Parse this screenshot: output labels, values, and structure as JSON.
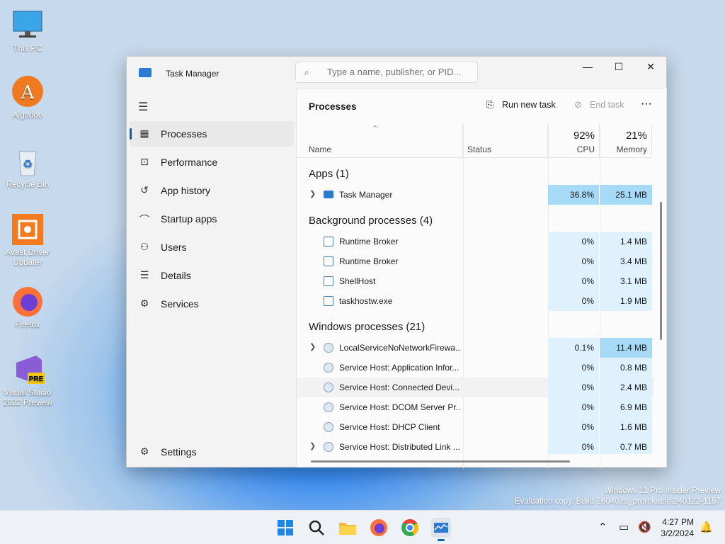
{
  "desktop": {
    "icons": [
      {
        "label": "This PC"
      },
      {
        "label": "Algodoo"
      },
      {
        "label": "Recycle Bin"
      },
      {
        "label": "Avast Driver Updater"
      },
      {
        "label": "Firefox"
      },
      {
        "label": "Visual Studio 2022 Preview"
      }
    ],
    "watermark": {
      "line1": "Windows 11 Pro Insider Preview",
      "line2": "Evaluation copy. Build 26040.rs_prerelease.240122-1157"
    }
  },
  "window": {
    "title": "Task Manager",
    "search_placeholder": "Type a name, publisher, or PID...",
    "controls": {
      "minimize": "—",
      "maximize": "☐",
      "close": "✕"
    }
  },
  "sidebar": {
    "items": [
      {
        "label": "Processes",
        "icon": "processes-icon"
      },
      {
        "label": "Performance",
        "icon": "performance-icon"
      },
      {
        "label": "App history",
        "icon": "history-icon"
      },
      {
        "label": "Startup apps",
        "icon": "startup-icon"
      },
      {
        "label": "Users",
        "icon": "users-icon"
      },
      {
        "label": "Details",
        "icon": "details-icon"
      },
      {
        "label": "Services",
        "icon": "services-icon"
      }
    ],
    "settings_label": "Settings"
  },
  "toolbar": {
    "page_title": "Processes",
    "run_new_task": "Run new task",
    "end_task": "End task",
    "more": "···"
  },
  "columns": {
    "name": "Name",
    "status": "Status",
    "cpu_pct": "92%",
    "cpu_label": "CPU",
    "mem_pct": "21%",
    "mem_label": "Memory"
  },
  "groups": [
    {
      "title": "Apps (1)",
      "rows": [
        {
          "name": "Task Manager",
          "cpu": "36.8%",
          "mem": "25.1 MB",
          "expandable": true
        }
      ]
    },
    {
      "title": "Background processes (4)",
      "rows": [
        {
          "name": "Runtime Broker",
          "cpu": "0%",
          "mem": "1.4 MB"
        },
        {
          "name": "Runtime Broker",
          "cpu": "0%",
          "mem": "3.4 MB"
        },
        {
          "name": "ShellHost",
          "cpu": "0%",
          "mem": "3.1 MB"
        },
        {
          "name": "taskhostw.exe",
          "cpu": "0%",
          "mem": "1.9 MB"
        }
      ]
    },
    {
      "title": "Windows processes (21)",
      "rows": [
        {
          "name": "LocalServiceNoNetworkFirewa...",
          "cpu": "0.1%",
          "mem": "11.4 MB",
          "expandable": true
        },
        {
          "name": "Service Host: Application Infor...",
          "cpu": "0%",
          "mem": "0.8 MB"
        },
        {
          "name": "Service Host: Connected Devi...",
          "cpu": "0%",
          "mem": "2.4 MB"
        },
        {
          "name": "Service Host: DCOM Server Pr...",
          "cpu": "0%",
          "mem": "6.9 MB"
        },
        {
          "name": "Service Host: DHCP Client",
          "cpu": "0%",
          "mem": "1.6 MB"
        },
        {
          "name": "Service Host: Distributed Link ...",
          "cpu": "0%",
          "mem": "0.7 MB",
          "expandable": true
        }
      ]
    }
  ],
  "taskbar": {
    "time": "4:27 PM",
    "date": "3/2/2024"
  }
}
